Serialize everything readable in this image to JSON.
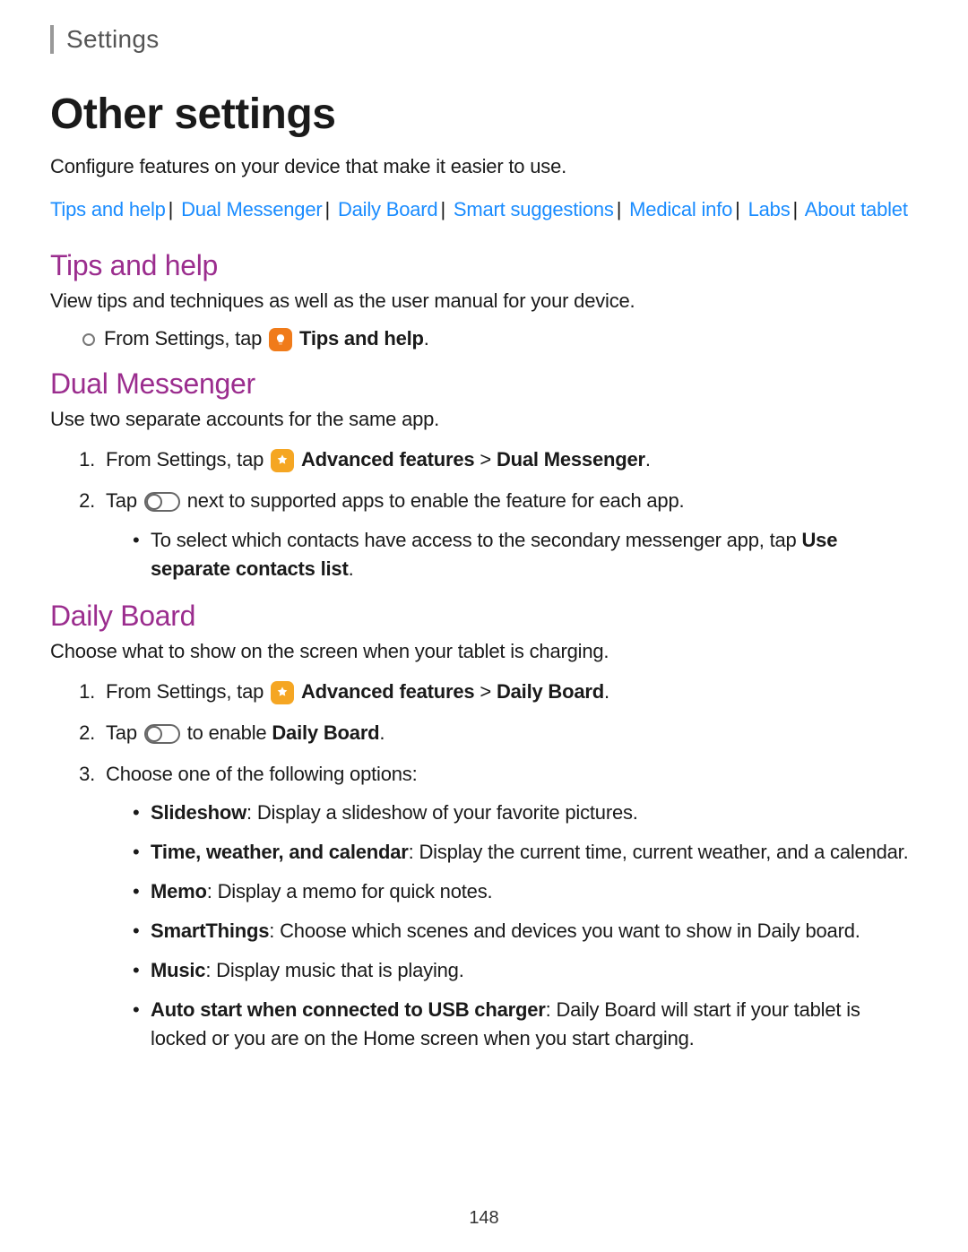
{
  "breadcrumb": "Settings",
  "title": "Other settings",
  "intro": "Configure features on your device that make it easier to use.",
  "toc": [
    "Tips and help",
    "Dual Messenger",
    "Daily Board",
    "Smart suggestions",
    "Medical info",
    "Labs",
    "About tablet"
  ],
  "tips": {
    "heading": "Tips and help",
    "intro": "View tips and techniques as well as the user manual for your device.",
    "step_prefix": "From Settings, tap",
    "step_label": "Tips and help"
  },
  "dual": {
    "heading": "Dual Messenger",
    "intro": "Use two separate accounts for the same app.",
    "s1_prefix": "From Settings, tap",
    "s1_b1": "Advanced features",
    "s1_gt": ">",
    "s1_b2": "Dual Messenger",
    "s2_prefix": "Tap",
    "s2_suffix": "next to supported apps to enable the feature for each app.",
    "sub_text": "To select which contacts have access to the secondary messenger app, tap ",
    "sub_bold": "Use separate contacts list"
  },
  "daily": {
    "heading": "Daily Board",
    "intro": "Choose what to show on the screen when your tablet is charging.",
    "s1_prefix": "From Settings, tap",
    "s1_b1": "Advanced features",
    "s1_gt": ">",
    "s1_b2": "Daily Board",
    "s2_prefix": "Tap",
    "s2_mid": "to enable ",
    "s2_bold": "Daily Board",
    "s3": "Choose one of the following options:",
    "opts": [
      {
        "b": "Slideshow",
        "t": ": Display a slideshow of your favorite pictures."
      },
      {
        "b": "Time, weather, and calendar",
        "t": ": Display the current time, current weather, and a calendar."
      },
      {
        "b": "Memo",
        "t": ": Display a memo for quick notes."
      },
      {
        "b": "SmartThings",
        "t": ": Choose which scenes and devices you want to show in Daily board."
      },
      {
        "b": "Music",
        "t": ": Display music that is playing."
      },
      {
        "b": "Auto start when connected to USB charger",
        "t": ": Daily Board will start if your tablet is locked or you are on the Home screen when you start charging."
      }
    ]
  },
  "page": "148"
}
